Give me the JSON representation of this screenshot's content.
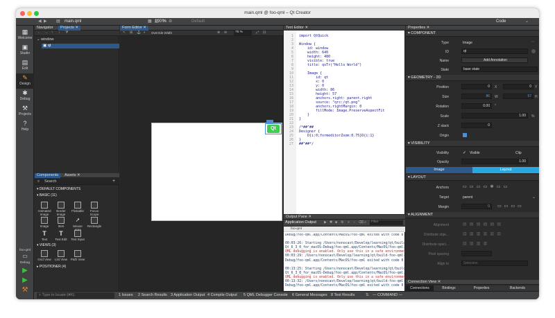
{
  "window": {
    "title": "main.qml @ foo-qml – Qt Creator"
  },
  "toolbar": {
    "file_name": "main.qml",
    "zoom": "100 %",
    "default_label": "Default",
    "code_label": "Code"
  },
  "modes": [
    {
      "label": "Welcome",
      "icon": "grid-icon"
    },
    {
      "label": "Studio",
      "icon": "studio-icon"
    },
    {
      "label": "Edit",
      "icon": "edit-icon"
    },
    {
      "label": "Design",
      "icon": "pencil-icon"
    },
    {
      "label": "Debug",
      "icon": "bug-icon"
    },
    {
      "label": "Projects",
      "icon": "wrench-icon"
    },
    {
      "label": "Help",
      "icon": "help-icon"
    }
  ],
  "kit": {
    "project": "foo-qml",
    "config": "Debug"
  },
  "navigator": {
    "tab_navigator": "Navigator",
    "tab_projects": "Projects",
    "tree": [
      {
        "label": "window"
      },
      {
        "label": "qt"
      }
    ]
  },
  "form_editor": {
    "tab": "Form Editor",
    "override_width": "Override Width",
    "zoom": "75 %"
  },
  "canvas": {
    "badge_text": "Qt",
    "badge_color": "#41cd52"
  },
  "components": {
    "tab_components": "Components",
    "tab_assets": "Assets",
    "search_placeholder": "Search",
    "default_header": "DEFAULT COMPONENTS",
    "basic_header": "BASIC (11)",
    "basic_items": [
      {
        "label": "Animated Image"
      },
      {
        "label": "Border Image"
      },
      {
        "label": "Flickable"
      },
      {
        "label": "Focus Scope"
      },
      {
        "label": "Image"
      },
      {
        "label": "Item"
      },
      {
        "label": "Mouse Area"
      },
      {
        "label": "Rectangle"
      },
      {
        "label": "Text"
      },
      {
        "label": "Text Edit"
      },
      {
        "label": "Text Input"
      }
    ],
    "views_header": "VIEWS (3)",
    "views_items": [
      {
        "label": "Grid View"
      },
      {
        "label": "List View"
      },
      {
        "label": "Path View"
      }
    ],
    "positioner_header": "POSITIONER (4)"
  },
  "text_editor": {
    "tab": "Text Editor",
    "lines": [
      {
        "n": "1",
        "text": "import QtQuick"
      },
      {
        "n": "2",
        "text": ""
      },
      {
        "n": "3",
        "text": "Window {"
      },
      {
        "n": "4",
        "text": "    id: window"
      },
      {
        "n": "5",
        "text": "    width: 640"
      },
      {
        "n": "6",
        "text": "    height: 480"
      },
      {
        "n": "7",
        "text": "    visible: true"
      },
      {
        "n": "8",
        "text": "    title: qsTr(\"Hello World\")"
      },
      {
        "n": "9",
        "text": ""
      },
      {
        "n": "10",
        "text": "    Image {"
      },
      {
        "n": "11",
        "text": "        id: qt"
      },
      {
        "n": "12",
        "text": "        x: 0"
      },
      {
        "n": "13",
        "text": "        y: 0"
      },
      {
        "n": "14",
        "text": "        width: 86"
      },
      {
        "n": "15",
        "text": "        height: 57"
      },
      {
        "n": "16",
        "text": "        anchors.right: parent.right"
      },
      {
        "n": "17",
        "text": "        source: \"qrc:/qt.png\""
      },
      {
        "n": "18",
        "text": "        anchors.rightMargin: 0"
      },
      {
        "n": "19",
        "text": "        fillMode: Image.PreserveAspectFit"
      },
      {
        "n": "20",
        "text": "    }"
      },
      {
        "n": "21",
        "text": "}"
      },
      {
        "n": "22",
        "text": ""
      },
      {
        "n": "23",
        "text": "/*##^##"
      },
      {
        "n": "24",
        "text": "Designer {"
      },
      {
        "n": "25",
        "text": "    D{i:0;formeditorZoom:0.75}D{i:1}"
      },
      {
        "n": "26",
        "text": "}"
      },
      {
        "n": "27",
        "text": "##^##*/"
      }
    ]
  },
  "output": {
    "pane_tab": "Output Pane",
    "app_output_tab": "Application Output",
    "run_tab": "foo-qml",
    "filter_placeholder": "Filter",
    "lines": [
      "Debug/foo-qml.app/Contents/MacOS/foo-qml exited with code 0",
      "",
      "00:03:26: Starting /Users/nonocast/Develop/learning/qt/build-f",
      "Qt_6_3_0_for_macOS-Debug/foo-qml.app/Contents/MacOS/foo-qml...",
      "QML debugging is enabled. Only use this in a safe environment.",
      "00:03:29: /Users/nonocast/Develop/learning/qt/build-foo-qml-",
      "Debug/foo-qml.app/Contents/MacOS/foo-qml exited with code 0",
      "",
      "00:13:25: Starting /Users/nonocast/Develop/learning/qt/build-f",
      "Qt_6_3_0_for_macOS-Debug/foo-qml.app/Contents/MacOS/foo-qml...",
      "QML debugging is enabled. Only use this in a safe environment.",
      "00:13:32: /Users/nonocast/Develop/learning/qt/build-foo-qml-",
      "Debug/foo-qml.app/Contents/MacOS/foo-qml exited with code 0"
    ]
  },
  "properties": {
    "tab": "Properties",
    "component_header": "COMPONENT",
    "type_label": "Type",
    "type_value": "Image",
    "id_label": "ID",
    "id_value": "qt",
    "name_label": "Name",
    "add_annotation": "Add Annotation",
    "state_label": "State",
    "state_value": "base state",
    "geometry_header": "GEOMETRY - 2D",
    "position_label": "Position",
    "pos_x": "0",
    "pos_x_axis": "X",
    "pos_y": "0",
    "pos_y_axis": "Y",
    "size_label": "Size",
    "size_w": "86",
    "size_w_axis": "W",
    "size_h": "57",
    "size_h_axis": "H",
    "rotation_label": "Rotation",
    "rotation_value": "0.00",
    "scale_label": "Scale",
    "scale_value": "1.00",
    "scale_unit": "%",
    "zstack_label": "Z stack",
    "zstack_value": "0",
    "origin_label": "Origin",
    "visibility_header": "VISIBILITY",
    "visibility_label": "Visibility",
    "visible_check": "Visible",
    "clip_check": "Clip",
    "opacity_label": "Opacity",
    "opacity_value": "1.00",
    "tab_image": "Image",
    "tab_layout": "Layout",
    "layout_header": "LAYOUT",
    "anchors_label": "Anchors",
    "target_label": "Target",
    "target_value": "parent",
    "margin_label": "Margin",
    "margin_value": "0",
    "alignment_header": "ALIGNMENT",
    "alignment_label": "Alignment",
    "distribute_objects_label": "Distribute obje...",
    "distribute_spacing_label": "Distribute spaci...",
    "pixel_spacing_label": "Pixel spacing",
    "align_to_label": "Align to",
    "align_to_value": "Selection"
  },
  "connections": {
    "tab": "Connection View",
    "tabs": [
      {
        "label": "Connections"
      },
      {
        "label": "Bindings"
      },
      {
        "label": "Properties"
      },
      {
        "label": "Backends"
      }
    ]
  },
  "statusbar": {
    "locate_placeholder": "Type to locate (⌘K)",
    "items": [
      {
        "label": "1  Issues"
      },
      {
        "label": "2  Search Results"
      },
      {
        "label": "3  Application Output"
      },
      {
        "label": "4  Compile Output"
      },
      {
        "label": "5  QML Debugger Console"
      },
      {
        "label": "6  General Messages"
      },
      {
        "label": "8  Test Results"
      }
    ],
    "command_label": "— COMMAND —"
  }
}
